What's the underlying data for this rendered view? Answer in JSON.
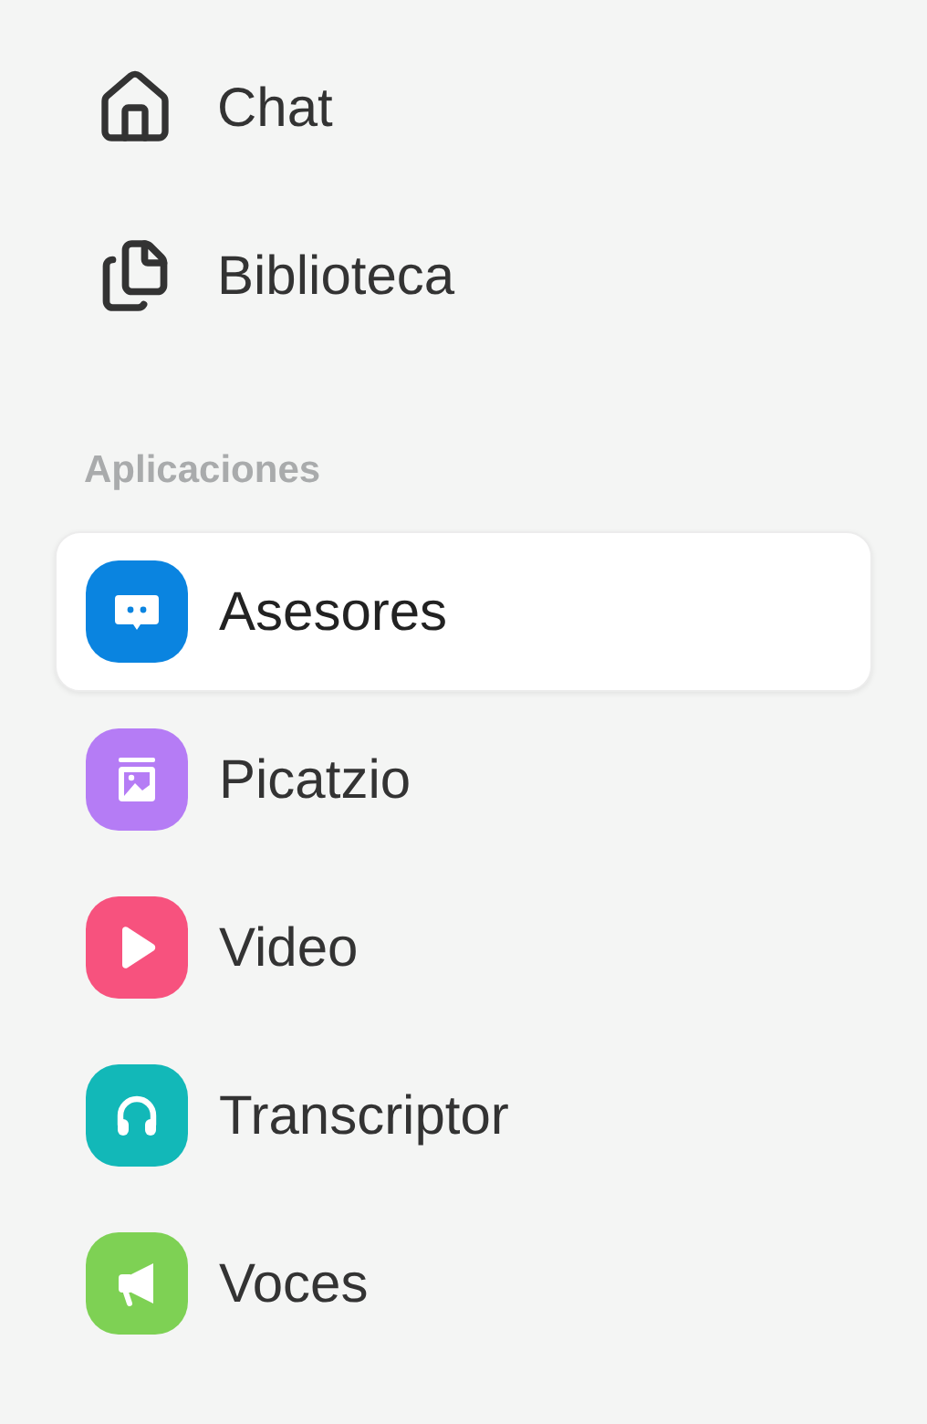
{
  "nav": [
    {
      "label": "Chat",
      "kind": "home"
    },
    {
      "label": "Biblioteca",
      "kind": "files"
    }
  ],
  "section": {
    "title": "Aplicaciones"
  },
  "apps": [
    {
      "label": "Asesores",
      "kind": "chat",
      "color": "#0a84e0",
      "selected": true
    },
    {
      "label": "Picatzio",
      "kind": "image",
      "color": "#b57cf5",
      "selected": false
    },
    {
      "label": "Video",
      "kind": "play",
      "color": "#f7527e",
      "selected": false
    },
    {
      "label": "Transcriptor",
      "kind": "headphones",
      "color": "#12b8b8",
      "selected": false
    },
    {
      "label": "Voces",
      "kind": "megaphone",
      "color": "#7ed154",
      "selected": false
    }
  ]
}
